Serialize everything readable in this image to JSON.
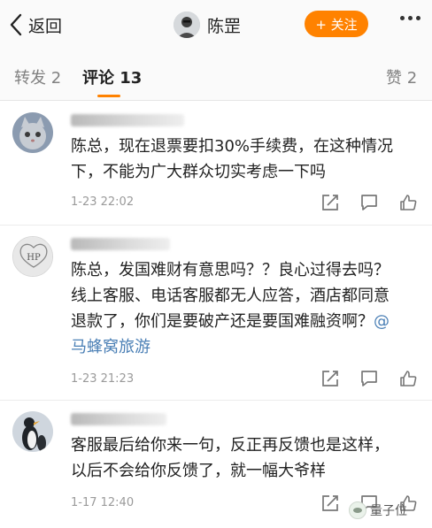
{
  "nav": {
    "back_label": "返回",
    "user_name": "陈罡",
    "follow_label": "+ 关注",
    "accent_color": "#ff8200"
  },
  "tabs": {
    "repost": "转发 2",
    "comments": "评论 13",
    "likes": "赞 2",
    "active": "comments"
  },
  "comments": [
    {
      "avatar": "cat-avatar",
      "text": "陈总，现在退票要扣30%手续费，在这种情况下，不能为广大群众切实考虑一下吗",
      "time": "1-23 22:02"
    },
    {
      "avatar": "monogram-avatar",
      "text_before_mention": "陈总，发国难财有意思吗？？良心过得去吗？线上客服、电话客服都无人应答，酒店都同意退款了，你们是要破产还是要国难融资啊？",
      "mention": "@马蜂窝旅游",
      "time": "1-23 21:23"
    },
    {
      "avatar": "penguin-avatar",
      "text": "客服最后给你来一句，反正再反馈也是这样，以后不会给你反馈了，就一幅大爷样",
      "time": "1-17 12:40"
    }
  ],
  "icons": {
    "reply": "reply-icon",
    "comment": "comment-icon",
    "like": "like-icon"
  },
  "watermark": {
    "text": "量子位"
  }
}
